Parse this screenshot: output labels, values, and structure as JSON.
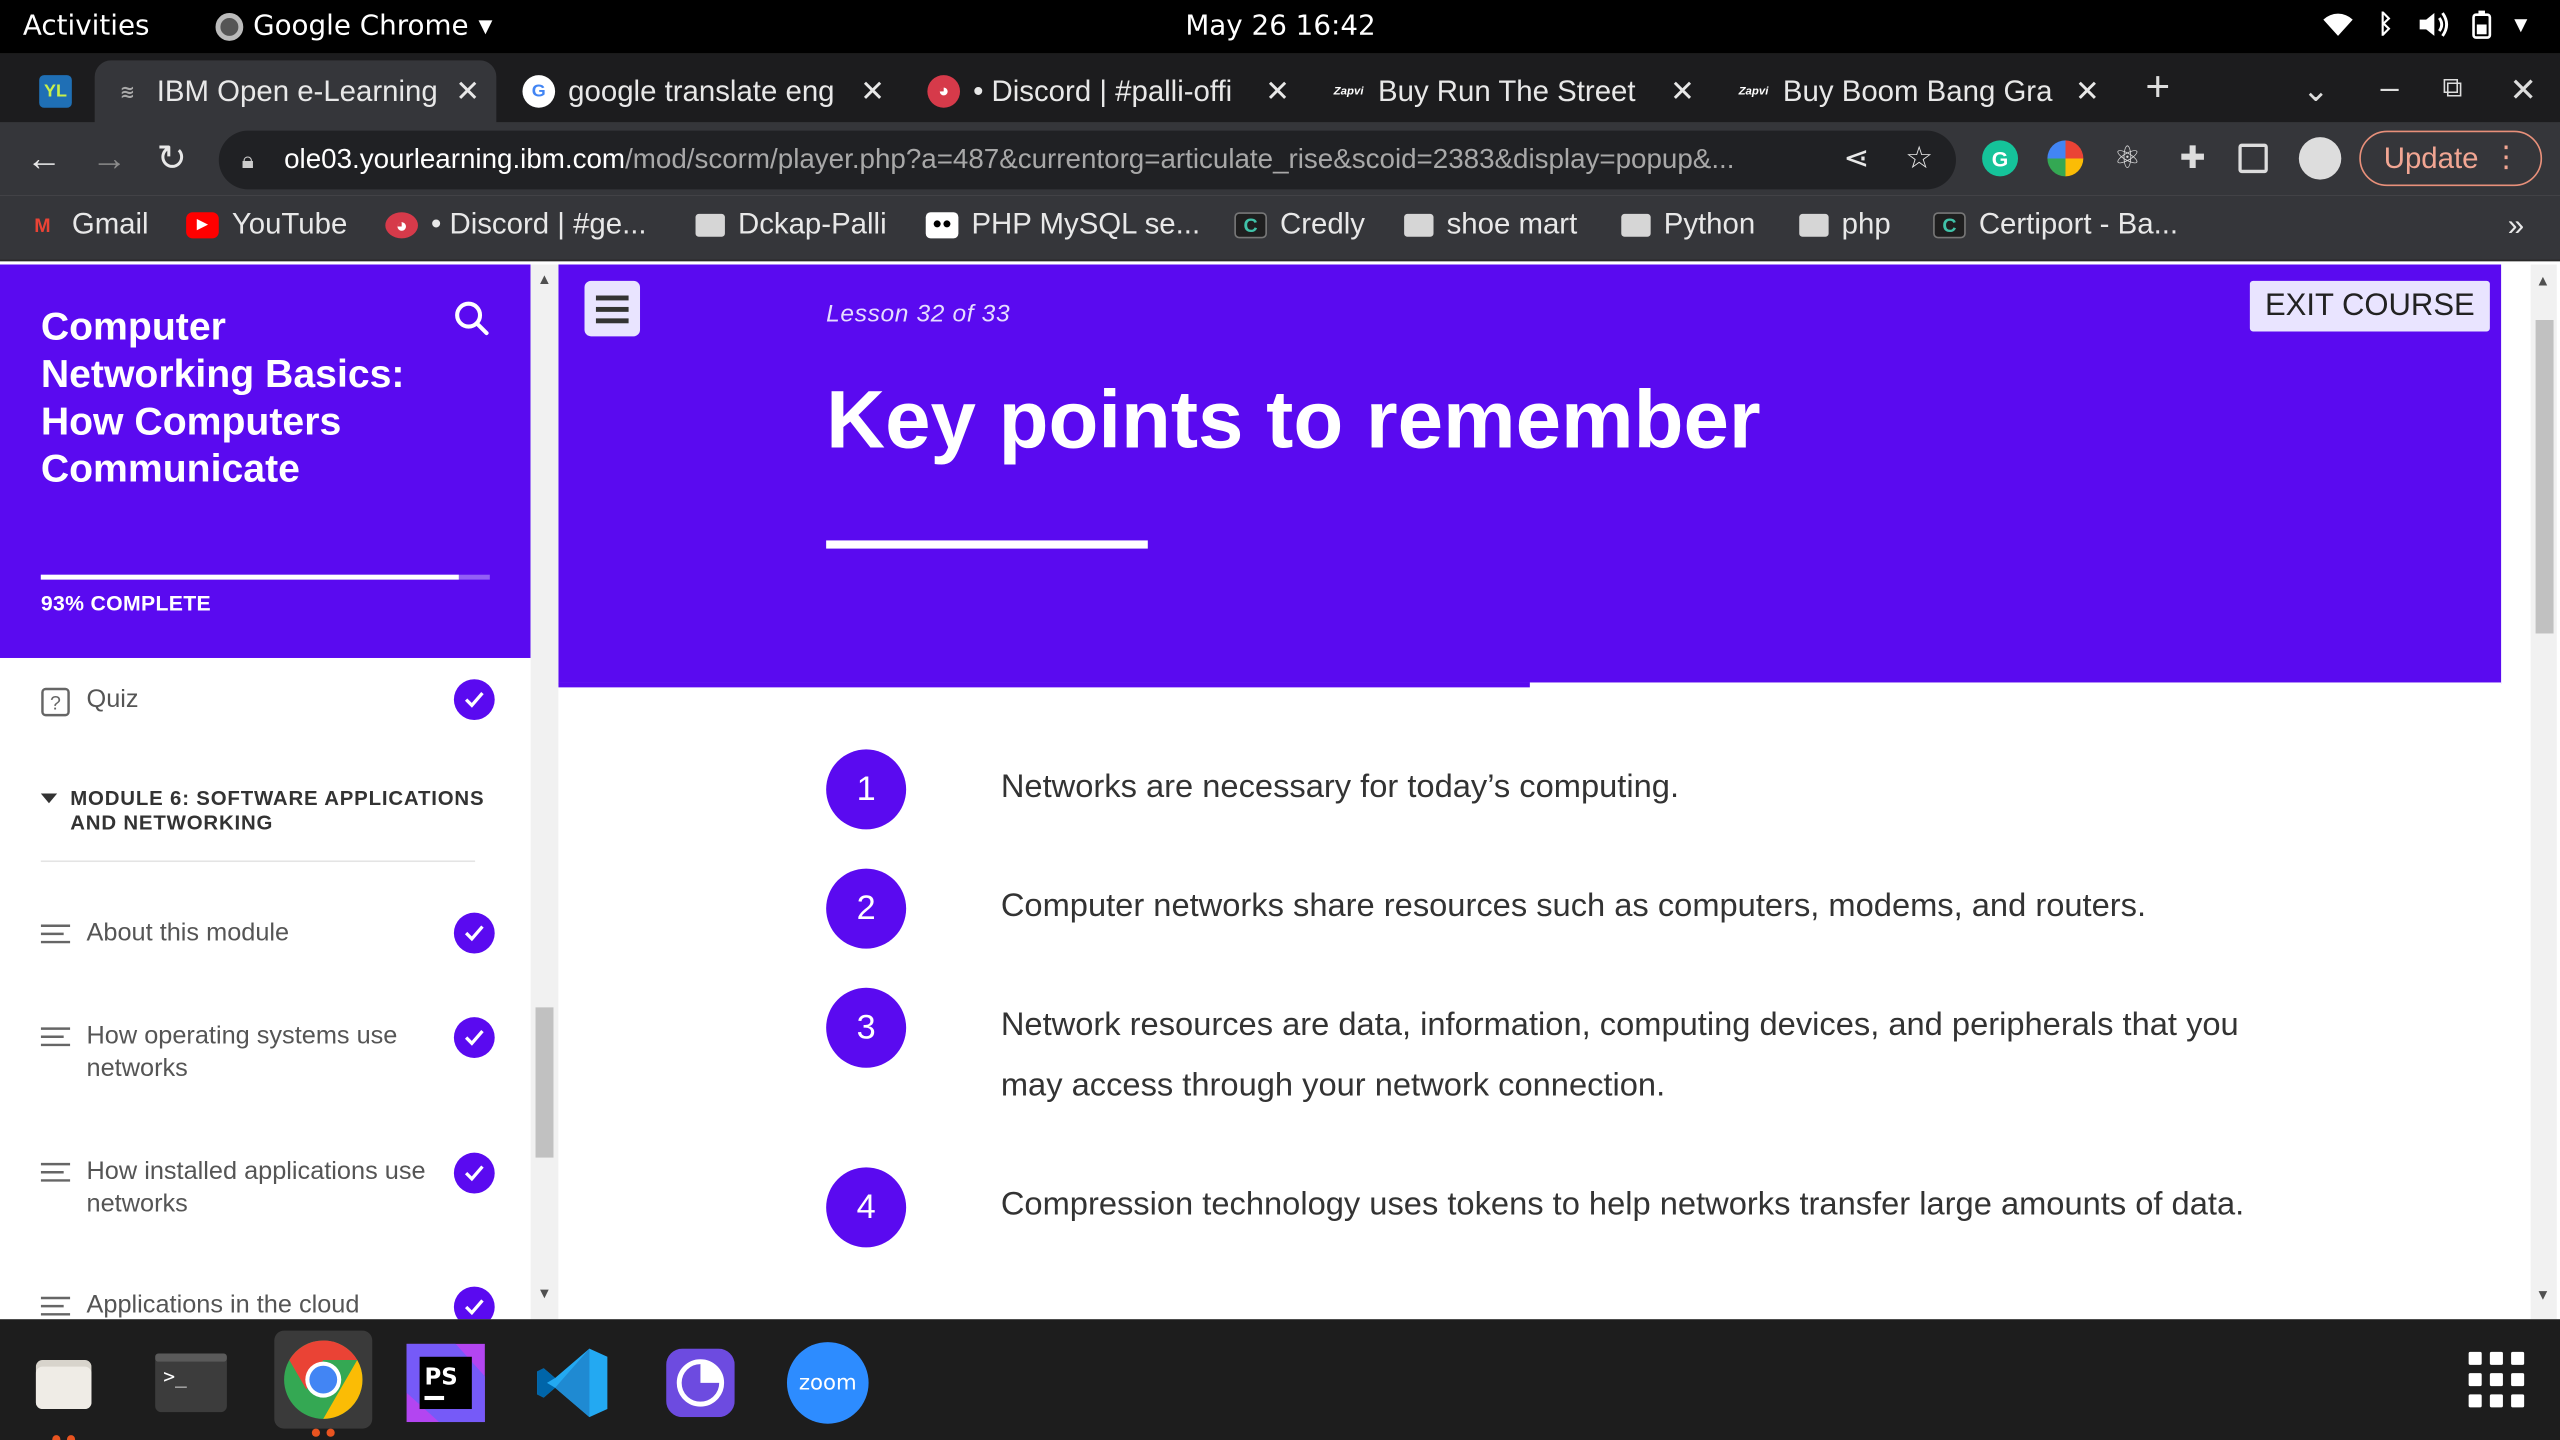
{
  "system": {
    "activities": "Activities",
    "app_name": "Google Chrome",
    "clock": "May 26  16:42"
  },
  "browser": {
    "tabs": [
      {
        "favicon_text": "YL",
        "title": "",
        "active": false
      },
      {
        "favicon_text": "",
        "title": "IBM Open e-Learning",
        "active": true
      },
      {
        "favicon_text": "G",
        "title": "google translate eng",
        "active": false
      },
      {
        "favicon_text": "",
        "title": "• Discord | #palli-offi",
        "active": false
      },
      {
        "favicon_text": "Zapvi",
        "title": "Buy Run The Street",
        "active": false
      },
      {
        "favicon_text": "Zapvi",
        "title": "Buy Boom Bang Gra",
        "active": false
      }
    ],
    "new_tab": "+",
    "url_host": "ole03.yourlearning.ibm.com",
    "url_path": "/mod/scorm/player.php?a=487&currentorg=articulate_rise&scoid=2383&display=popup&...",
    "update_label": "Update",
    "bookmarks": [
      {
        "icon": "gmail-icon",
        "label": "Gmail"
      },
      {
        "icon": "youtube-icon",
        "label": "YouTube"
      },
      {
        "icon": "discord-icon",
        "label": "• Discord | #ge..."
      },
      {
        "icon": "folder-icon",
        "label": "Dckap-Palli"
      },
      {
        "icon": "medium-icon",
        "label": "PHP MySQL se..."
      },
      {
        "icon": "credly-icon",
        "label": "Credly"
      },
      {
        "icon": "folder-icon",
        "label": "shoe mart"
      },
      {
        "icon": "folder-icon",
        "label": "Python"
      },
      {
        "icon": "folder-icon",
        "label": "php"
      },
      {
        "icon": "credly-icon",
        "label": "Certiport - Ba..."
      }
    ],
    "bookmarks_more": "»"
  },
  "course": {
    "title": "Computer Networking Basics: How Computers Communicate",
    "progress_percent": 93,
    "progress_label": "93% COMPLETE",
    "sidebar_items": [
      {
        "label": "Quiz",
        "icon": "quiz-icon",
        "completed": true
      },
      {
        "label": "About this module",
        "icon": "lesson-lines-icon",
        "completed": true
      },
      {
        "label": "How operating systems use networks",
        "icon": "lesson-lines-icon",
        "completed": true
      },
      {
        "label": "How installed applications use networks",
        "icon": "lesson-lines-icon",
        "completed": true
      },
      {
        "label": "Applications in the cloud",
        "icon": "lesson-lines-icon",
        "completed": true
      }
    ],
    "module_heading": "MODULE 6: SOFTWARE APPLICATIONS AND NETWORKING"
  },
  "lesson": {
    "counter": "Lesson 32 of 33",
    "title": "Key points to remember",
    "exit_label": "EXIT COURSE",
    "scroll_progress": 0.5,
    "key_points": [
      {
        "number": "1",
        "text": "Networks are necessary for today’s computing."
      },
      {
        "number": "2",
        "text": "Computer networks share resources such as computers, modems, and routers."
      },
      {
        "number": "3",
        "text": "Network resources are data, information, computing devices, and peripherals that you may access through your network connection."
      },
      {
        "number": "4",
        "text": "Compression technology uses tokens to help networks transfer large amounts of data."
      }
    ]
  },
  "dock": {
    "apps": [
      "files-icon",
      "terminal-icon",
      "chrome-icon",
      "phpstorm-icon",
      "vscode-icon",
      "screen-recorder-icon",
      "zoom-icon"
    ],
    "zoom_label": "zoom",
    "phpstorm_label": "PS"
  },
  "colors": {
    "brand_purple": "#5a0af0",
    "chrome_dark": "#35363a"
  }
}
